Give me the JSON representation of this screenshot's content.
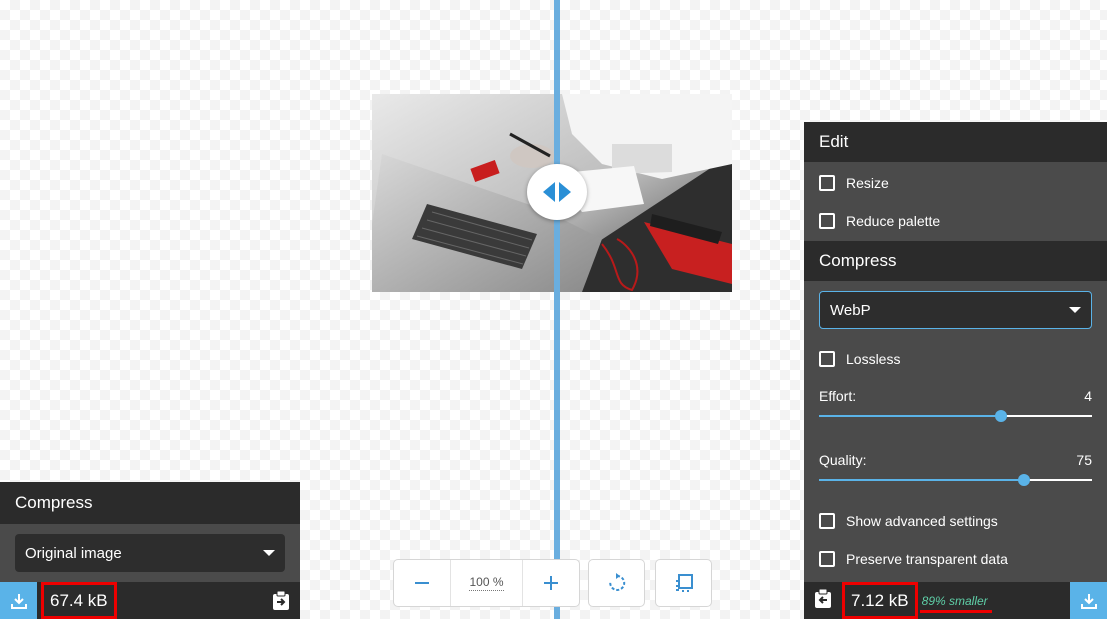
{
  "colors": {
    "accent": "#5ab3e8",
    "divider": "#6aaedf",
    "panel_header": "#2b2b2b",
    "highlight": "#ee0000",
    "savings_text": "#5fd0a8"
  },
  "toolbar": {
    "zoom_value": "100",
    "zoom_unit": "%",
    "zoom_out_icon": "minus-icon",
    "zoom_in_icon": "plus-icon",
    "rotate_icon": "rotate-icon",
    "background_icon": "checkerboard-icon"
  },
  "left_panel": {
    "header": "Compress",
    "select_value": "Original image",
    "file_size": "67.4 kB",
    "download_icon": "download-icon",
    "copy_icon": "copy-settings-right-icon"
  },
  "right_panel": {
    "edit_header": "Edit",
    "edit_options": [
      {
        "label": "Resize",
        "checked": false
      },
      {
        "label": "Reduce palette",
        "checked": false
      }
    ],
    "compress_header": "Compress",
    "select_value": "WebP",
    "lossless_label": "Lossless",
    "effort": {
      "label": "Effort:",
      "value": "4",
      "min": 0,
      "max": 6
    },
    "quality": {
      "label": "Quality:",
      "value": "75",
      "min": 0,
      "max": 100
    },
    "advanced_label": "Show advanced settings",
    "preserve_label": "Preserve transparent data",
    "file_size": "7.12 kB",
    "savings": "89% smaller",
    "download_icon": "download-icon",
    "copy_icon": "copy-settings-left-icon"
  }
}
